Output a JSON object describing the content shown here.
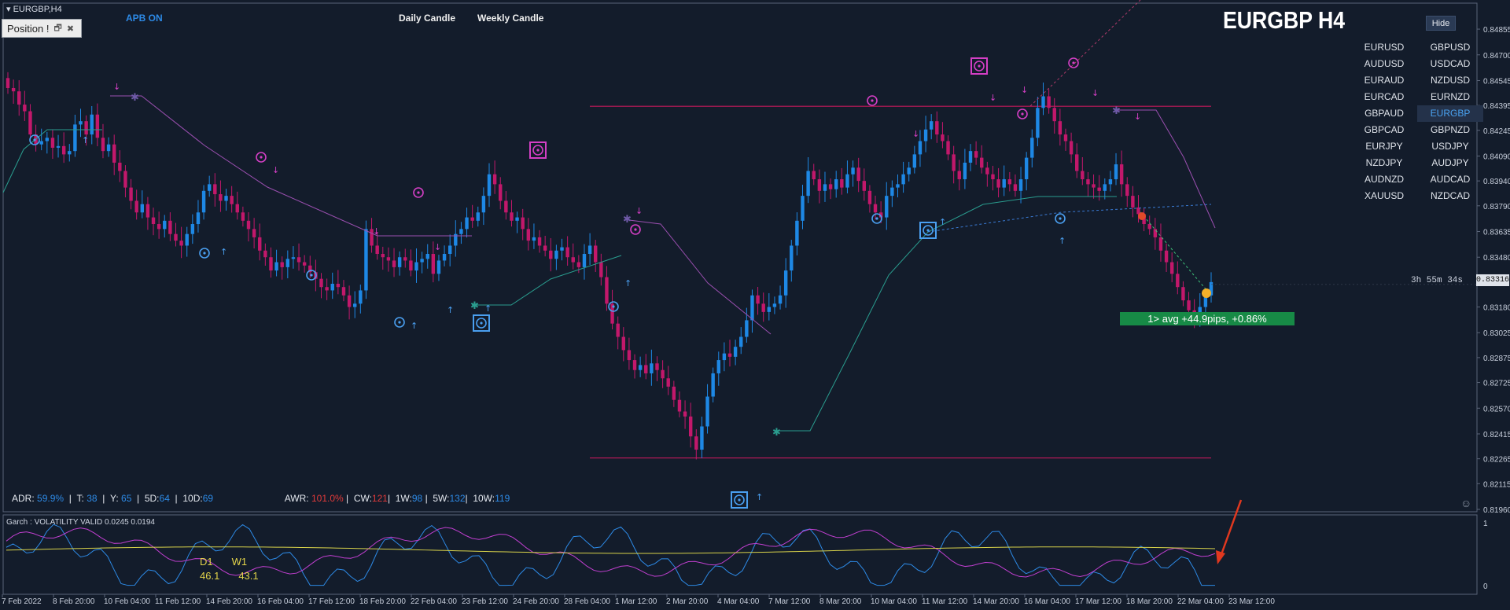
{
  "window": {
    "title": "EURGBP,H4"
  },
  "position_panel": {
    "label": "Position !"
  },
  "toolbar": {
    "apb": "APB ON",
    "daily": "Daily Candle",
    "weekly": "Weekly Candle",
    "hide": "Hide"
  },
  "chart_title": "EURGBP H4",
  "symbols": [
    "EURUSD",
    "GBPUSD",
    "AUDUSD",
    "USDCAD",
    "EURAUD",
    "NZDUSD",
    "EURCAD",
    "EURNZD",
    "GBPAUD",
    "EURGBP",
    "GBPCAD",
    "GBPNZD",
    "EURJPY",
    "USDJPY",
    "NZDJPY",
    "AUDJPY",
    "AUDNZD",
    "AUDCAD",
    "XAUUSD",
    "NZDCAD"
  ],
  "active_symbol": "EURGBP",
  "countdown": "3h 55m 34s",
  "current_price": "0.83316",
  "avg_banner": "1> avg +44.9pips, +0.86%",
  "stats": {
    "adr_label": "ADR:",
    "adr": "59.9%",
    "t_label": "T:",
    "t": "38",
    "y_label": "Y:",
    "y": "65",
    "d5_label": "5D:",
    "d5": "64",
    "d10_label": "10D:",
    "d10": "69",
    "awr_label": "AWR:",
    "awr": "101.0%",
    "cw_label": "CW:",
    "cw": "121",
    "w1_label": "1W:",
    "w1": "98",
    "w5_label": "5W:",
    "w5": "132",
    "w10_label": "10W:",
    "w10": "119"
  },
  "indicator": {
    "label": "Garch : VOLATILITY VALID 0.0245 0.0194",
    "d1_label": "D1",
    "w1_label": "W1",
    "d1_value": "46.1",
    "w1_value": "43.1",
    "axis_top": "1",
    "axis_bottom": "0"
  },
  "price_axis": [
    "0.84855",
    "0.84700",
    "0.84545",
    "0.84395",
    "0.84245",
    "0.84090",
    "0.83940",
    "0.83790",
    "0.83635",
    "0.83480",
    "0.83316",
    "0.83180",
    "0.83025",
    "0.82875",
    "0.82725",
    "0.82570",
    "0.82415",
    "0.82265",
    "0.82115",
    "0.81960"
  ],
  "time_axis": [
    "7 Feb 2022",
    "8 Feb 20:00",
    "10 Feb 04:00",
    "11 Feb 12:00",
    "14 Feb 20:00",
    "16 Feb 04:00",
    "17 Feb 12:00",
    "18 Feb 20:00",
    "22 Feb 04:00",
    "23 Feb 12:00",
    "24 Feb 20:00",
    "28 Feb 04:00",
    "1 Mar 12:00",
    "2 Mar 20:00",
    "4 Mar 04:00",
    "7 Mar 12:00",
    "8 Mar 20:00",
    "10 Mar 04:00",
    "11 Mar 12:00",
    "14 Mar 20:00",
    "16 Mar 04:00",
    "17 Mar 12:00",
    "18 Mar 20:00",
    "22 Mar 04:00",
    "23 Mar 12:00"
  ],
  "colors": {
    "background": "#131c2b",
    "bull": "#1e88e5",
    "bear": "#c2186b",
    "level_line": "#c2185b",
    "trail_bear": "#9b4fb0",
    "trail_bull": "#2a9d8f",
    "arrow_annotation": "#e0381f",
    "banner": "#178a46"
  },
  "chart_data": {
    "type": "candlestick",
    "symbol": "EURGBP",
    "timeframe": "H4",
    "y_range": [
      0.8196,
      0.8486
    ],
    "levels": [
      0.8439,
      0.8227
    ],
    "closes": [
      0.845,
      0.8448,
      0.844,
      0.8436,
      0.8422,
      0.8416,
      0.8418,
      0.842,
      0.8414,
      0.8415,
      0.841,
      0.8412,
      0.8428,
      0.843,
      0.8422,
      0.8434,
      0.842,
      0.8412,
      0.8416,
      0.8405,
      0.84,
      0.839,
      0.8382,
      0.8375,
      0.838,
      0.8372,
      0.8368,
      0.8365,
      0.837,
      0.8362,
      0.8358,
      0.8355,
      0.8362,
      0.8368,
      0.8375,
      0.8388,
      0.8392,
      0.8386,
      0.8382,
      0.8385,
      0.838,
      0.8375,
      0.837,
      0.8365,
      0.836,
      0.8352,
      0.8348,
      0.834,
      0.8345,
      0.8342,
      0.8347,
      0.8348,
      0.8345,
      0.8343,
      0.8339,
      0.8335,
      0.833,
      0.8328,
      0.8332,
      0.833,
      0.8325,
      0.8318,
      0.832,
      0.8328,
      0.8365,
      0.8355,
      0.835,
      0.8348,
      0.8346,
      0.8342,
      0.8348,
      0.8346,
      0.834,
      0.8345,
      0.8347,
      0.835,
      0.8338,
      0.8346,
      0.835,
      0.8355,
      0.8362,
      0.8365,
      0.8372,
      0.837,
      0.8375,
      0.8385,
      0.8398,
      0.8392,
      0.8382,
      0.8375,
      0.837,
      0.8372,
      0.8365,
      0.8358,
      0.836,
      0.8355,
      0.8352,
      0.8347,
      0.8352,
      0.8354,
      0.8348,
      0.8345,
      0.8342,
      0.835,
      0.8355,
      0.8345,
      0.8336,
      0.832,
      0.8308,
      0.83,
      0.8292,
      0.8286,
      0.828,
      0.8283,
      0.8278,
      0.8284,
      0.828,
      0.8275,
      0.827,
      0.8262,
      0.8255,
      0.8252,
      0.824,
      0.8232,
      0.8246,
      0.8264,
      0.8278,
      0.8286,
      0.829,
      0.8288,
      0.8294,
      0.83,
      0.831,
      0.8325,
      0.832,
      0.8315,
      0.8318,
      0.832,
      0.8325,
      0.834,
      0.8355,
      0.837,
      0.8385,
      0.84,
      0.8395,
      0.8388,
      0.8392,
      0.8389,
      0.8395,
      0.839,
      0.8398,
      0.8402,
      0.8394,
      0.8388,
      0.838,
      0.8375,
      0.8372,
      0.8385,
      0.839,
      0.8392,
      0.8398,
      0.8402,
      0.841,
      0.8418,
      0.8425,
      0.843,
      0.8422,
      0.8418,
      0.841,
      0.84,
      0.8395,
      0.8405,
      0.8412,
      0.8408,
      0.8402,
      0.8398,
      0.8395,
      0.839,
      0.8395,
      0.8392,
      0.8388,
      0.8395,
      0.8408,
      0.842,
      0.8438,
      0.8445,
      0.8438,
      0.843,
      0.8422,
      0.8418,
      0.841,
      0.84,
      0.8395,
      0.8392,
      0.839,
      0.8388,
      0.8392,
      0.8395,
      0.8404,
      0.8392,
      0.8385,
      0.8378,
      0.8374,
      0.8368,
      0.8365,
      0.836,
      0.8352,
      0.8345,
      0.8338,
      0.833,
      0.8322,
      0.8316,
      0.8312,
      0.8318,
      0.8325,
      0.8333
    ]
  }
}
